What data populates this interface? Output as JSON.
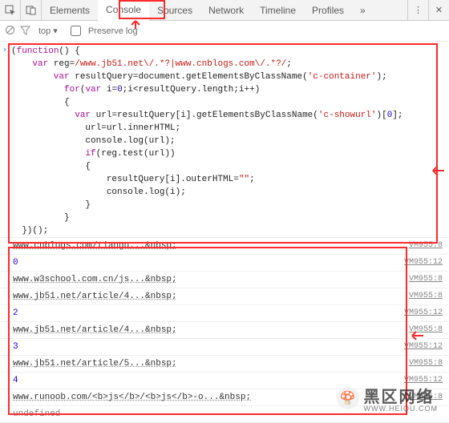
{
  "tabs": {
    "elements": "Elements",
    "console": "Console",
    "sources": "Sources",
    "network": "Network",
    "timeline": "Timeline",
    "profiles": "Profiles",
    "more": "»"
  },
  "toolbar": {
    "context": "top",
    "preserve_label": "Preserve log"
  },
  "code": {
    "l1": "(function() {",
    "l2_a": "    var",
    "l2_b": " reg=",
    "l2_c": "/www.jb51.net\\/.*?|www.cnblogs.com\\/.*?/",
    "l2_d": ";",
    "l3_a": "        var",
    "l3_b": " resultQuery=document.getElementsByClassName(",
    "l3_c": "'c-container'",
    "l3_d": ");",
    "l4_a": "          for",
    "l4_b": "(",
    "l4_c": "var",
    "l4_d": " i=",
    "l4_e": "0",
    "l4_f": ";i<resultQuery.length;i++)",
    "l5": "          {",
    "l6_a": "            var",
    "l6_b": " url=resultQuery[i].getElementsByClassName(",
    "l6_c": "'c-showurl'",
    "l6_d": ")[",
    "l6_e": "0",
    "l6_f": "];",
    "l7": "              url=url.innerHTML;",
    "l8": "              console.log(url);",
    "l9_a": "              if",
    "l9_b": "(reg.test(url))",
    "l10": "              {",
    "l11_a": "                  resultQuery[i].outerHTML=",
    "l11_b": "\"\"",
    "l11_c": ";",
    "l12": "                  console.log(i);",
    "l13": "              }",
    "l14": "          }",
    "l15": "  })();"
  },
  "logs": [
    {
      "msg": "www.cnblogs.com/tiangu...&nbsp;",
      "src": "VM955:8",
      "type": "url"
    },
    {
      "msg": "0",
      "src": "VM955:12",
      "type": "num"
    },
    {
      "msg": "www.w3school.com.cn/js...&nbsp;",
      "src": "VM955:8",
      "type": "url"
    },
    {
      "msg": "www.jb51.net/article/4...&nbsp;",
      "src": "VM955:8",
      "type": "url"
    },
    {
      "msg": "2",
      "src": "VM955:12",
      "type": "num"
    },
    {
      "msg": "www.jb51.net/article/4...&nbsp;",
      "src": "VM955:8",
      "type": "url"
    },
    {
      "msg": "3",
      "src": "VM955:12",
      "type": "num"
    },
    {
      "msg": "www.jb51.net/article/5...&nbsp;",
      "src": "VM955:8",
      "type": "url"
    },
    {
      "msg": "4",
      "src": "VM955:12",
      "type": "num"
    },
    {
      "msg": "www.runoob.com/<b>js</b>/<b>js</b>-o...&nbsp;",
      "src": "VM955:8",
      "type": "url"
    },
    {
      "msg": "undefined",
      "src": "",
      "type": "undef"
    }
  ],
  "watermark": {
    "title": "黑区网络",
    "sub": "WWW.HEIQU.COM"
  }
}
